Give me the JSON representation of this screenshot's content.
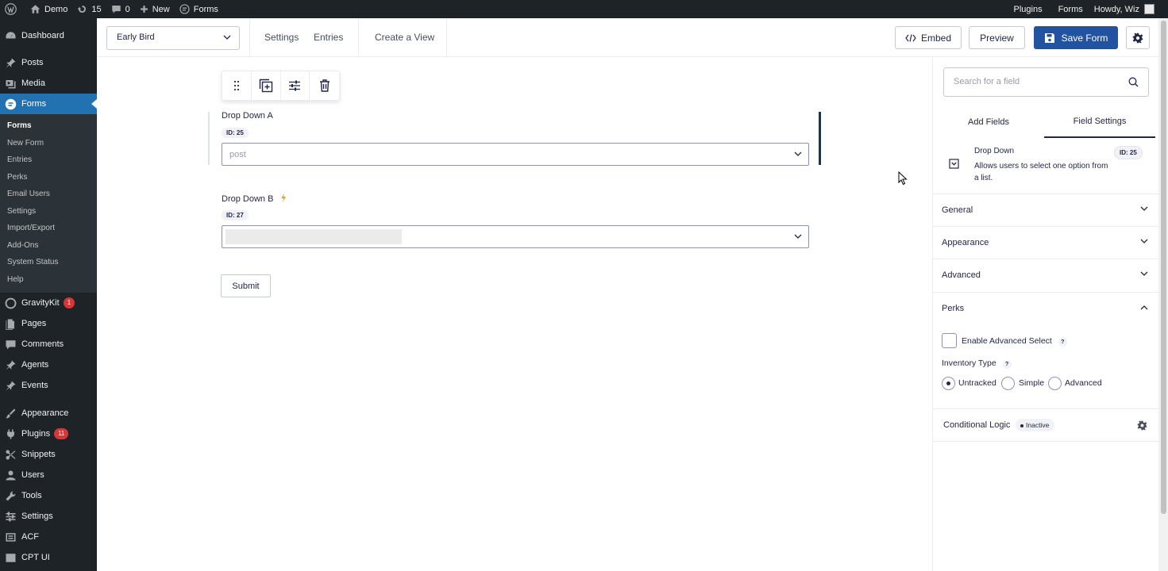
{
  "adminbar": {
    "site": "Demo",
    "updates": "15",
    "comments": "0",
    "new": "New",
    "forms": "Forms",
    "right": {
      "plugins": "Plugins",
      "forms": "Forms",
      "howdy": "Howdy, Wiz"
    }
  },
  "sidebar": {
    "dashboard": "Dashboard",
    "posts": "Posts",
    "media": "Media",
    "forms": "Forms",
    "forms_sub": [
      "Forms",
      "New Form",
      "Entries",
      "Perks",
      "Email Users",
      "Settings",
      "Import/Export",
      "Add-Ons",
      "System Status",
      "Help"
    ],
    "gravitykit": "GravityKit",
    "gravitykit_badge": "1",
    "pages": "Pages",
    "comments": "Comments",
    "agents": "Agents",
    "events": "Events",
    "appearance": "Appearance",
    "plugins": "Plugins",
    "plugins_badge": "11",
    "snippets": "Snippets",
    "users": "Users",
    "tools": "Tools",
    "settings": "Settings",
    "acf": "ACF",
    "cptui": "CPT UI"
  },
  "toolbar": {
    "form_name": "Early Bird",
    "settings": "Settings",
    "entries": "Entries",
    "create_view": "Create a View",
    "embed": "Embed",
    "preview": "Preview",
    "save": "Save Form"
  },
  "canvas": {
    "field_a": {
      "label": "Drop Down A",
      "id": "ID: 25",
      "value": "post"
    },
    "field_b": {
      "label": "Drop Down B",
      "id": "ID: 27"
    },
    "submit": "Submit"
  },
  "panel": {
    "search_placeholder": "Search for a field",
    "tab_add": "Add Fields",
    "tab_settings": "Field Settings",
    "field_type": "Drop Down",
    "field_desc": "Allows users to select one option from a list.",
    "field_id": "ID: 25",
    "sections": [
      "General",
      "Appearance",
      "Advanced",
      "Perks"
    ],
    "enable_advanced_select": "Enable Advanced Select",
    "inventory_type": "Inventory Type",
    "radios": [
      "Untracked",
      "Simple",
      "Advanced"
    ],
    "selected_radio": "Untracked",
    "conditional_logic": "Conditional Logic",
    "conditional_status": "Inactive"
  },
  "colors": {
    "admin_dark": "#1d2327",
    "wp_blue": "#2271b1",
    "gf_primary": "#2153a0",
    "accent_bar": "#0e3a5b"
  }
}
